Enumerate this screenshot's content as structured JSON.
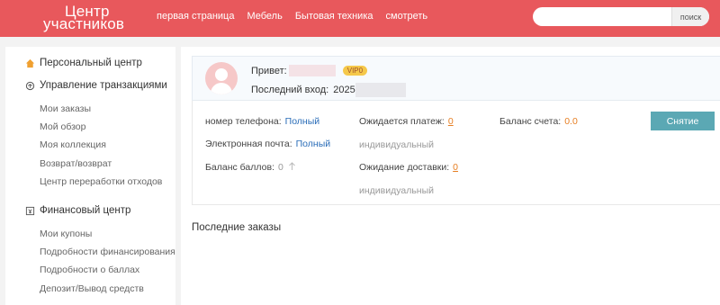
{
  "header": {
    "logo_line1": "Центр",
    "logo_line2": "участников",
    "nav": [
      "первая страница",
      "Мебель",
      "Бытовая техника",
      "смотреть"
    ],
    "search_placeholder": "",
    "search_button": "поиск"
  },
  "sidebar": {
    "personal_center": "Персональный центр",
    "transactions_title": "Управление транзакциями",
    "transactions_items": [
      "Мои заказы",
      "Мой обзор",
      "Моя коллекция",
      "Возврат/возврат",
      "Центр переработки отходов"
    ],
    "finance_title": "Финансовый центр",
    "finance_items": [
      "Мои купоны",
      "Подробности финансирования",
      "Подробности о баллах",
      "Депозит/Вывод средств"
    ]
  },
  "user": {
    "greeting": "Привет:",
    "vip": "VIP0",
    "last_login_label": "Последний вход:",
    "last_login_value": "2025"
  },
  "info": {
    "phone_label": "номер телефона:",
    "phone_value": "Полный",
    "email_label": "Электронная почта:",
    "email_value": "Полный",
    "points_label": "Баланс баллов:",
    "points_value": "0",
    "pending_payment_label": "Ожидается платеж:",
    "pending_payment_value": "0",
    "individual_1": "индивидуальный",
    "awaiting_delivery_label": "Ожидание доставки:",
    "awaiting_delivery_value": "0",
    "individual_2": "индивидуальный",
    "balance_label": "Баланс счета:",
    "balance_value": "0.0",
    "withdraw_button": "Снятие"
  },
  "recent_orders_title": "Последние заказы",
  "colors": {
    "header_bg": "#e8585c",
    "withdraw_bg": "#5ba8b4",
    "link_blue": "#2a6db8",
    "accent_orange": "#e67e22"
  },
  "icons": {
    "personal": "home-icon",
    "transactions": "refresh-icon",
    "finance": "wallet-icon",
    "points": "arrow-up-icon"
  }
}
